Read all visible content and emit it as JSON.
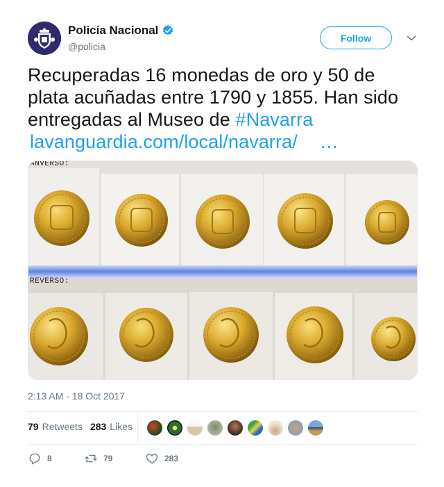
{
  "author": {
    "name": "Policía Nacional",
    "handle": "@policia",
    "verified": true,
    "avatar_icon": "police-crest-icon"
  },
  "follow_label": "Follow",
  "tweet": {
    "line1": "Recuperadas 16 monedas de oro y 50 de",
    "line2": "plata acuñadas entre 1790 y 1855. Han sido",
    "line3_text": "entregadas al Museo de ",
    "hashtag": "#Navarra",
    "link": "lavanguardia.com/local/navarra/",
    "ellipsis": "…"
  },
  "photo": {
    "label_top": "ANVERSO:",
    "label_bottom": "REVERSO:",
    "description_icon": "gold-coins-photo"
  },
  "timestamp": "2:13 AM - 18 Oct 2017",
  "stats": {
    "retweets_count": "79",
    "retweets_label": "Retweets",
    "likes_count": "283",
    "likes_label": "Likes"
  },
  "actions": {
    "reply_count": "8",
    "retweet_count": "79",
    "like_count": "283"
  },
  "colors": {
    "accent": "#1da1f2",
    "text": "#14171a",
    "muted": "#657786",
    "gold": "#d4a52a"
  }
}
